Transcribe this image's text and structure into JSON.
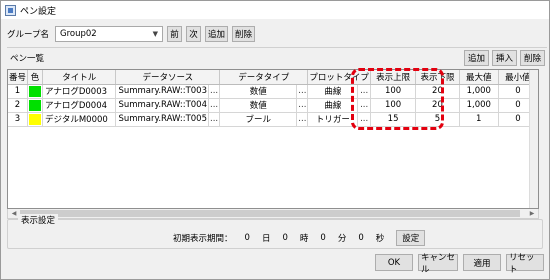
{
  "window": {
    "title": "ペン設定",
    "title_icon": "pen-settings-icon"
  },
  "group": {
    "label": "グループ名",
    "value": "Group02",
    "prev_label": "前",
    "next_label": "次",
    "add_label": "追加",
    "delete_label": "削除"
  },
  "pen_list": {
    "title": "ペン一覧",
    "add_label": "追加",
    "insert_label": "挿入",
    "delete_label": "削除",
    "headers": [
      "番号",
      "色",
      "タイトル",
      "データソース",
      "",
      "データタイプ",
      "",
      "プロットタイプ",
      "",
      "表示上限",
      "表示下限",
      "最大値",
      "最小値"
    ],
    "rows": [
      {
        "no": "1",
        "color": "#00e000",
        "title": "アナログD0003",
        "source": "Summary.RAW::T003",
        "dots1": "...",
        "dtype": "数値",
        "dots2": "...",
        "ptype": "曲線",
        "dots3": "...",
        "upper": "100",
        "lower": "20",
        "max": "1,000",
        "min": "0"
      },
      {
        "no": "2",
        "color": "#00e000",
        "title": "アナログD0004",
        "source": "Summary.RAW::T004",
        "dots1": "...",
        "dtype": "数値",
        "dots2": "...",
        "ptype": "曲線",
        "dots3": "...",
        "upper": "100",
        "lower": "20",
        "max": "1,000",
        "min": "0"
      },
      {
        "no": "3",
        "color": "#ffff00",
        "title": "デジタルM0000",
        "source": "Summary.RAW::T005",
        "dots1": "...",
        "dtype": "ブール",
        "dots2": "...",
        "ptype": "トリガー",
        "dots3": "...",
        "upper": "15",
        "lower": "5",
        "max": "1",
        "min": "0"
      }
    ]
  },
  "display_settings": {
    "legend": "表示設定",
    "period_label": "初期表示期間：",
    "days": "0",
    "days_unit": "日",
    "hours": "0",
    "hours_unit": "時",
    "minutes": "0",
    "minutes_unit": "分",
    "seconds": "0",
    "seconds_unit": "秒",
    "set_label": "設定"
  },
  "footer": {
    "ok_label": "OK",
    "cancel_label": "キャンセル",
    "apply_label": "適用",
    "reset_label": "リセット"
  },
  "colors": {
    "highlight": "#e3000f"
  }
}
